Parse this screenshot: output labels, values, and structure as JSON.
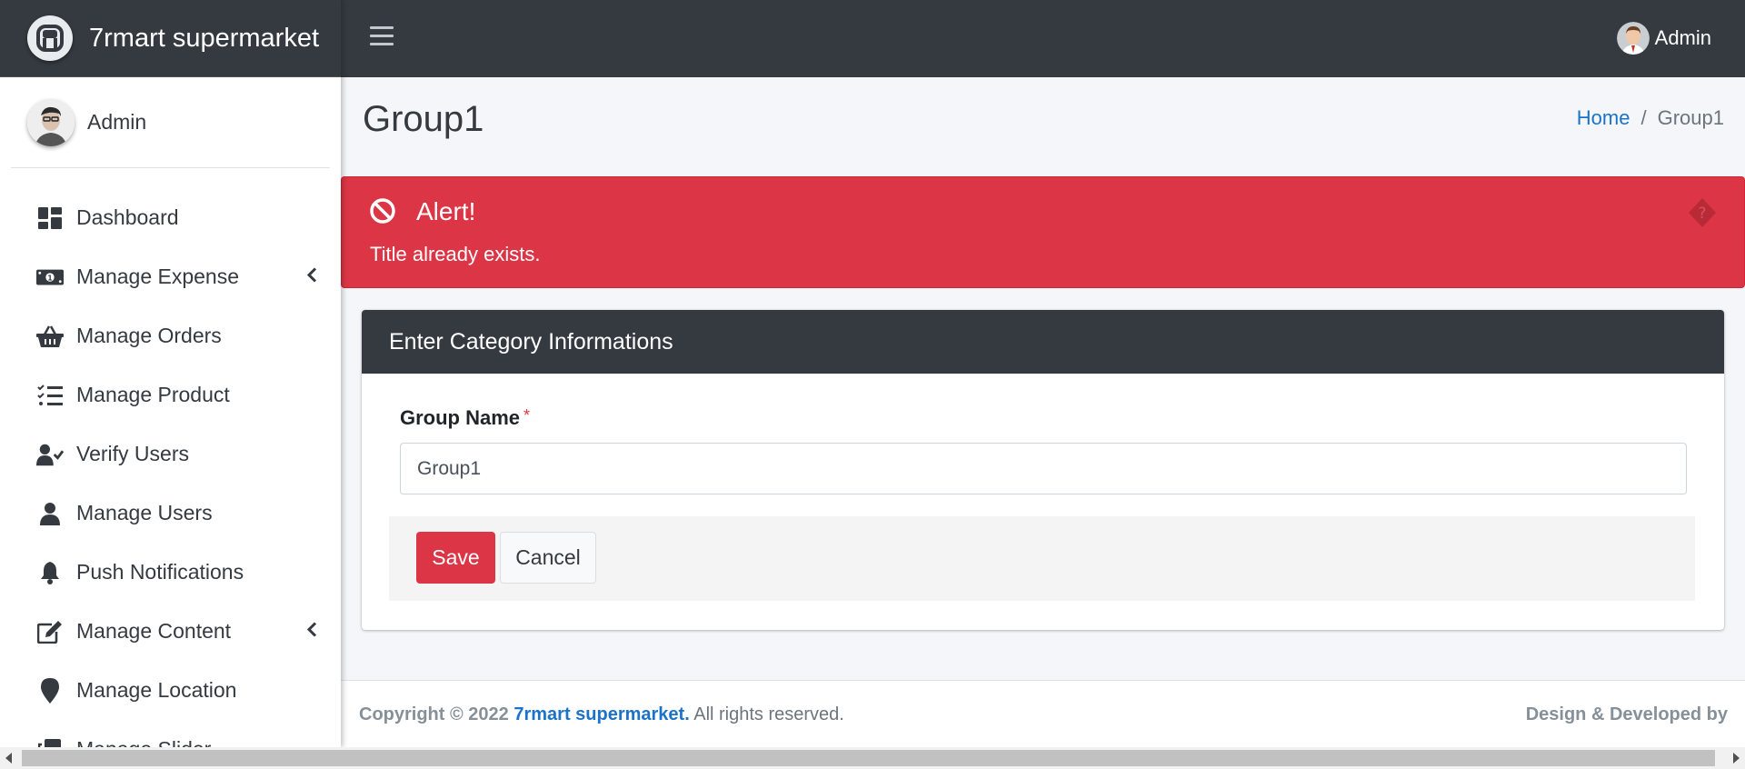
{
  "brand": {
    "name": "7rmart supermarket"
  },
  "sidebar": {
    "user_name": "Admin",
    "items": [
      {
        "label": "Dashboard",
        "icon": "dashboard-icon",
        "has_submenu": false
      },
      {
        "label": "Manage Expense",
        "icon": "money-bill-icon",
        "has_submenu": true
      },
      {
        "label": "Manage Orders",
        "icon": "basket-icon",
        "has_submenu": false
      },
      {
        "label": "Manage Product",
        "icon": "tasks-list-icon",
        "has_submenu": false
      },
      {
        "label": "Verify Users",
        "icon": "user-check-icon",
        "has_submenu": false
      },
      {
        "label": "Manage Users",
        "icon": "user-icon",
        "has_submenu": false
      },
      {
        "label": "Push Notifications",
        "icon": "bell-icon",
        "has_submenu": false
      },
      {
        "label": "Manage Content",
        "icon": "edit-icon",
        "has_submenu": true
      },
      {
        "label": "Manage Location",
        "icon": "map-marker-icon",
        "has_submenu": false
      },
      {
        "label": "Manage Slider",
        "icon": "clone-icon",
        "has_submenu": false
      }
    ]
  },
  "topbar": {
    "user_name": "Admin"
  },
  "page": {
    "title": "Group1",
    "breadcrumb": {
      "home": "Home",
      "separator": "/",
      "current": "Group1"
    }
  },
  "alert": {
    "title": "Alert!",
    "message": "Title already exists.",
    "color": "#dc3545"
  },
  "form": {
    "header": "Enter Category Informations",
    "group_name_label": "Group Name",
    "required_mark": "*",
    "group_name_value": "Group1",
    "save_label": "Save",
    "cancel_label": "Cancel"
  },
  "footer": {
    "copyright_prefix": "Copyright © 2022",
    "brand_link": "7rmart supermarket.",
    "rights": "All rights reserved.",
    "credit": "Design & Developed by"
  },
  "colors": {
    "dark": "#343a40",
    "danger": "#dc3545",
    "link": "#1a73c8"
  }
}
